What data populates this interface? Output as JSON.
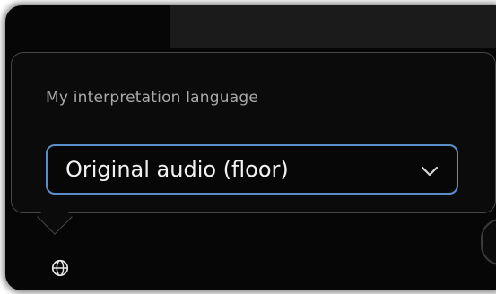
{
  "popup": {
    "title": "My interpretation language",
    "dropdown": {
      "selected_value": "Original audio (floor)"
    }
  },
  "icons": {
    "dropdown": "chevron-down-icon",
    "language": "globe-icon"
  }
}
